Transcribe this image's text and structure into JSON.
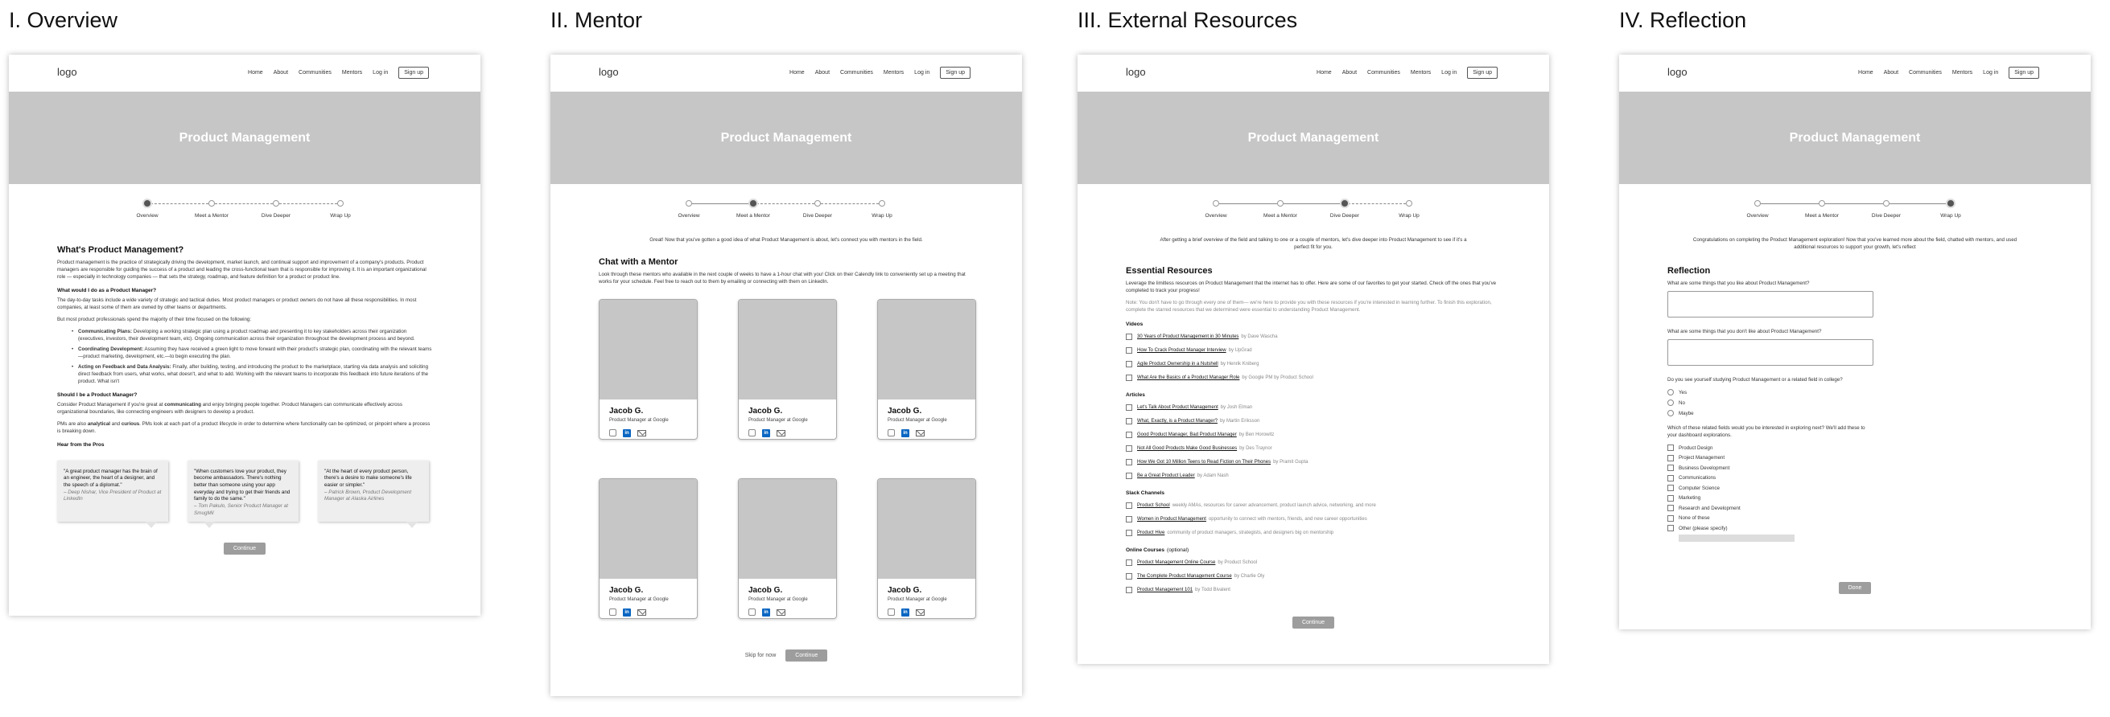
{
  "nav": {
    "logo": "logo",
    "links": [
      "Home",
      "About",
      "Communities",
      "Mentors",
      "Log in"
    ],
    "signup": "Sign up"
  },
  "hero_title": "Product Management",
  "progress_steps": [
    "Overview",
    "Meet a Mentor",
    "Dive Deeper",
    "Wrap Up"
  ],
  "sections": {
    "overview": {
      "title": "I. Overview",
      "heading": "What's Product Management?",
      "intro": "Product management is the practice of strategically driving the development, market launch, and continual support and improvement of a company's products. Product managers are responsible for guiding the success of a product and leading the cross-functional team that is responsible for improving it. It is an important organizational role — especially in technology companies — that sets the strategy, roadmap, and feature definition for a product or product line.",
      "q1": "What would I do as a Product Manager?",
      "p1": "The day-to-day tasks include a wide variety of strategic and tactical duties. Most product managers or product owners do not have all these responsibilities. In most companies, at least some of them are owned by other teams or departments.",
      "p2": "But most product professionals spend the majority of their time focused on the following:",
      "bullets": [
        {
          "bold": "Communicating Plans:",
          "text": " Developing a working strategic plan using a product roadmap and presenting it to key stakeholders across their organization (executives, investors, their development team, etc). Ongoing communication across their organization throughout the development process and beyond."
        },
        {
          "bold": "Coordinating Development:",
          "text": " Assuming they have received a green light to move forward with their product's strategic plan, coordinating with the relevant teams—product marketing, development, etc.—to begin executing the plan."
        },
        {
          "bold": "Acting on Feedback and Data Analysis:",
          "text": " Finally, after building, testing, and introducing the product to the marketplace, starting via data analysis and soliciting direct feedback from users, what works, what doesn't, and what to add. Working with the relevant teams to incorporate this feedback into future iterations of the product. What isn't"
        }
      ],
      "q2": "Should I be a Product Manager?",
      "p3_a": "Consider Product Management if you're great at ",
      "p3_b": "communicating",
      "p3_c": " and enjoy bringing people together. Product Managers can communicate effectively across organizational boundaries, like connecting engineers with designers to develop a product.",
      "p4_a": "PMs are also ",
      "p4_b": "analytical",
      "p4_c": " and ",
      "p4_d": "curious",
      "p4_e": ". PMs look at each part of a product lifecycle in order to determine where functionality can be optimized, or pinpoint where a process is breaking down.",
      "q3": "Hear from the Pros",
      "quotes": [
        {
          "text": "\"A great product manager has the brain of an engineer, the heart of a designer, and the speech of a diplomat.\"",
          "author": "– Deep Nishar, Vice President of Product at LinkedIn"
        },
        {
          "text": "\"When customers love your product, they become ambassadors. There's nothing better than someone using your app everyday and trying to get their friends and family to do the same.\"",
          "author": "– Tom Pakulo, Senior Product Manager at SmugMil"
        },
        {
          "text": "\"At the heart of every product person, there's a desire to make someone's life easier or simpler.\"",
          "author": "– Patrick Brown, Product Development Manager at Alaska Airlines"
        }
      ],
      "button": "Continue"
    },
    "mentor": {
      "title": "II. Mentor",
      "intro": "Great! Now that you've gotten a good idea of what Product Management is about, let's connect you with mentors in the field.",
      "heading": "Chat with a Mentor",
      "desc": "Look through these mentors who available in the next couple of weeks to have a 1-hour chat with you! Click on their Calendly link to conveniently set up a meeting that works for your schedule. Feel free to reach out to them by emailing or connecting with them on LinkedIn.",
      "mentors": [
        {
          "name": "Jacob G.",
          "role": "Product Manager at Google"
        },
        {
          "name": "Jacob G.",
          "role": "Product Manager at Google"
        },
        {
          "name": "Jacob G.",
          "role": "Product Manager at Google"
        },
        {
          "name": "Jacob G.",
          "role": "Product Manager at Google"
        },
        {
          "name": "Jacob G.",
          "role": "Product Manager at Google"
        },
        {
          "name": "Jacob G.",
          "role": "Product Manager at Google"
        }
      ],
      "skip": "Skip for now",
      "button": "Continue"
    },
    "external": {
      "title": "III. External Resources",
      "intro": "After getting a brief overview of the field and talking to one or a couple of mentors, let's dive deeper into Product Management to see if it's a perfect fit for you.",
      "heading": "Essential Resources",
      "desc": "Leverage the limitless resources on Product Management that the internet has to offer. Here are some of our favorites to get your started. Check off the ones that you've completed to track your progress!",
      "note": "Note: You don't have to go through every one of them— we're here to provide you with these resources if you're interested in learning further. To finish this exploration, complete the starred resources that we determined were essential to understanding Product Management.",
      "categories": [
        {
          "name": "Videos",
          "items": [
            {
              "t": "30 Years of Product Management in 30 Minutes",
              "a": "by Dave Wascha"
            },
            {
              "t": "How To Crack Product Manager Interview",
              "a": "by UpGrad"
            },
            {
              "t": "Agile Product Ownership in a Nutshell",
              "a": "by Henrik Kniberg"
            },
            {
              "t": "What Are the Basics of a Product Manager Role",
              "a": "by Google PM by Product School"
            }
          ]
        },
        {
          "name": "Articles",
          "items": [
            {
              "t": "Let's Talk About Product Management",
              "a": "by Josh Elman"
            },
            {
              "t": "What, Exactly, is a Product Manager?",
              "a": "by Martin Eriksson"
            },
            {
              "t": "Good Product Manager, Bad Product Manager",
              "a": "by Ben Horowitz"
            },
            {
              "t": "Not All Good Products Make Good Businesses",
              "a": "by Des Traynor"
            },
            {
              "t": "How We Got 10 Million Teens to Read Fiction on Their Phones",
              "a": "by Pramit Gupta"
            },
            {
              "t": "Be a Great Product Leader",
              "a": "by Adam Nash"
            }
          ]
        },
        {
          "name": "Slack Channels",
          "items": [
            {
              "t": "Product School",
              "a": "weekly AMAs, resources for career advancement, product launch advice, networking, and more"
            },
            {
              "t": "Women in Product Management",
              "a": "opportunity to connect with mentors, friends, and new career opportunities"
            },
            {
              "t": "Product Hive",
              "a": "community of product managers, strategists, and designers big on mentorship"
            }
          ]
        },
        {
          "name": "Online Courses",
          "suffix": "(optional)",
          "items": [
            {
              "t": "Product Management Online Course",
              "a": "by Product School"
            },
            {
              "t": "The Complete Product Management Course",
              "a": "by Charlie Oly"
            },
            {
              "t": "Product Management 101",
              "a": "by Todd Bivalent"
            }
          ]
        }
      ],
      "button": "Continue"
    },
    "reflection": {
      "title": "IV. Reflection",
      "intro": "Congratulations on completing the Product Management exploration! Now that you've learned more about the field, chatted with mentors, and used additional resources to support your growth, let's reflect",
      "heading": "Reflection",
      "q1": "What are some things that you like about Product Management?",
      "q2": "What are some things that you don't like about Product Management?",
      "q3": "Do you see yourself studying Product Management or a related field in college?",
      "radios": [
        "Yes",
        "No",
        "Maybe"
      ],
      "q4": "Which of these related fields would you be interested in exploring next? We'll add these to your dashboard explorations.",
      "checks": [
        "Product Design",
        "Project Management",
        "Business Development",
        "Communications",
        "Computer Science",
        "Marketing",
        "Research and Development",
        "None of these",
        "Other (please specify)"
      ],
      "button": "Done"
    }
  }
}
